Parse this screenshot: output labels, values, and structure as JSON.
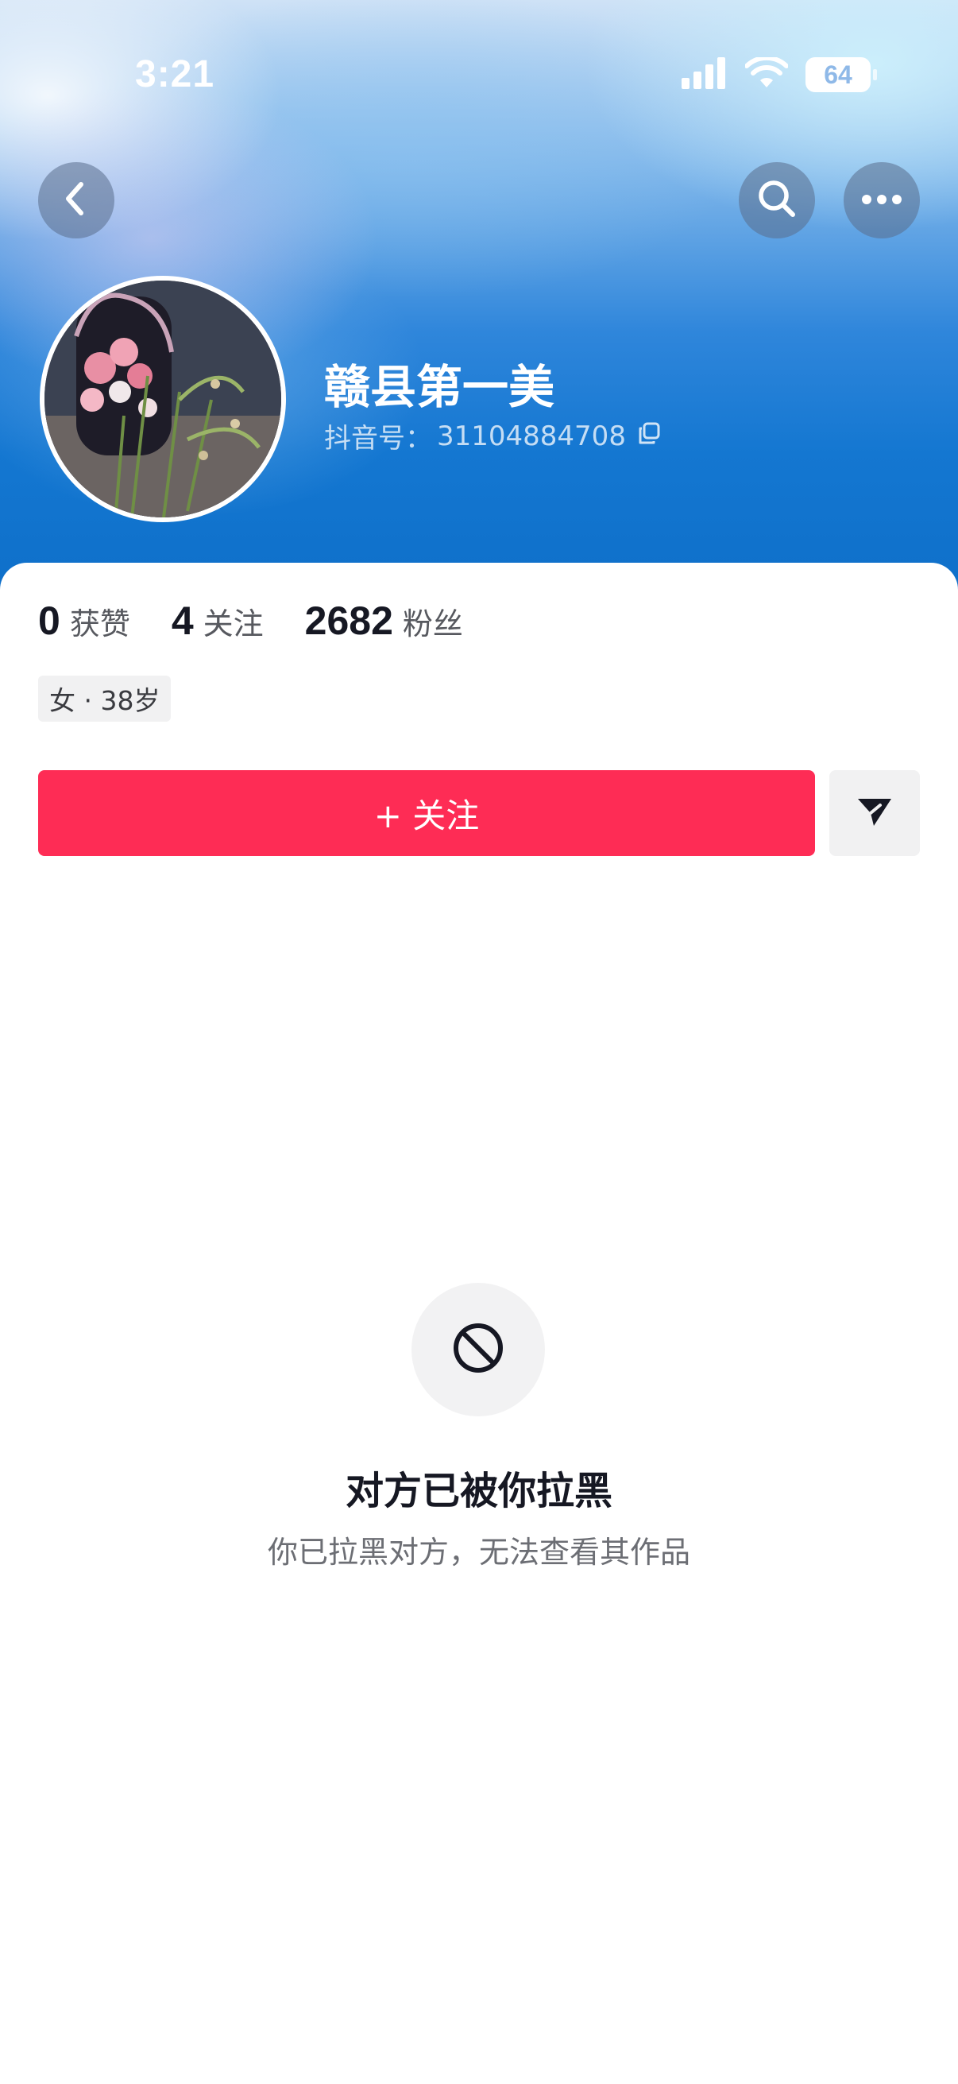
{
  "status_bar": {
    "time": "3:21",
    "battery": "64"
  },
  "nav": {
    "back_icon": "chevron-left-icon",
    "search_icon": "search-icon",
    "more_icon": "more-dots-icon"
  },
  "profile": {
    "nickname": "赣县第一美",
    "account_label": "抖音号：",
    "account_id": "31104884708",
    "copy_icon": "copy-icon"
  },
  "stats": [
    {
      "value": "0",
      "label": "获赞"
    },
    {
      "value": "4",
      "label": "关注"
    },
    {
      "value": "2682",
      "label": "粉丝"
    }
  ],
  "tag": "女 · 38岁",
  "actions": {
    "follow_label": "+ 关注",
    "share_icon": "send-icon"
  },
  "blocked": {
    "icon": "blocked-icon",
    "title": "对方已被你拉黑",
    "description": "你已拉黑对方，无法查看其作品"
  },
  "colors": {
    "accent": "#fe2c55",
    "hero_blue": "#1477d1"
  }
}
